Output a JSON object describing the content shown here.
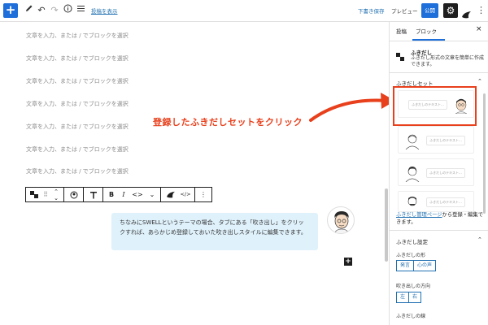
{
  "toolbar": {
    "add_block": "+",
    "view_post_link": "投稿を表示",
    "save_draft": "下書き保存",
    "preview": "プレビュー",
    "publish": "公開",
    "icons": [
      "plus-icon",
      "pencil-icon",
      "undo-icon",
      "redo-icon",
      "info-icon",
      "list-view-icon",
      "gear-icon",
      "swell-logo-icon",
      "more-vertical-icon"
    ],
    "accent": "#1e6fd9"
  },
  "editor": {
    "placeholders": [
      "文章を入力、または / でブロックを選択",
      "文章を入力、または / でブロックを選択",
      "文章を入力、または / でブロックを選択",
      "文章を入力、または / でブロックを選択",
      "文章を入力、または / でブロックを選択",
      "文章を入力、または / でブロックを選択",
      "文章を入力、または / でブロックを選択"
    ],
    "bubble_text_line1": "ちなみにSWELLというテーマの場合、タブにある「吹き出し」をクリッ",
    "bubble_text_line2": "クすれば、あらかじめ登録しておいた吹き出しスタイルに編集できます。",
    "block_toolbar": {
      "bold": "B",
      "italic": "I",
      "link": "<>",
      "more": "⌄",
      "code": "</>",
      "options": "⋮"
    }
  },
  "annotation": {
    "text": "登録したふきだしセットをクリック",
    "color": "#e8401c"
  },
  "sidebar": {
    "tabs": [
      "投稿",
      "ブロック"
    ],
    "active_tab": "ブロック",
    "close": "×",
    "block_title": "ふきだし",
    "block_desc": "ふきだし形式の文章を簡単に作成できます。",
    "preset_section": "ふきだしセット",
    "preset_placeholder": "ふきだしのテキスト...",
    "manage_link": "ふきだし管理ページ",
    "manage_suffix": "から登録・編集できます。",
    "settings_section": "ふきだし設定",
    "shape_label": "ふきだしの形",
    "shape_options": [
      "発言",
      "心の声"
    ],
    "direction_label": "吹き出しの方向",
    "direction_options": [
      "左",
      "右"
    ],
    "line_label": "ふきだしの線"
  }
}
